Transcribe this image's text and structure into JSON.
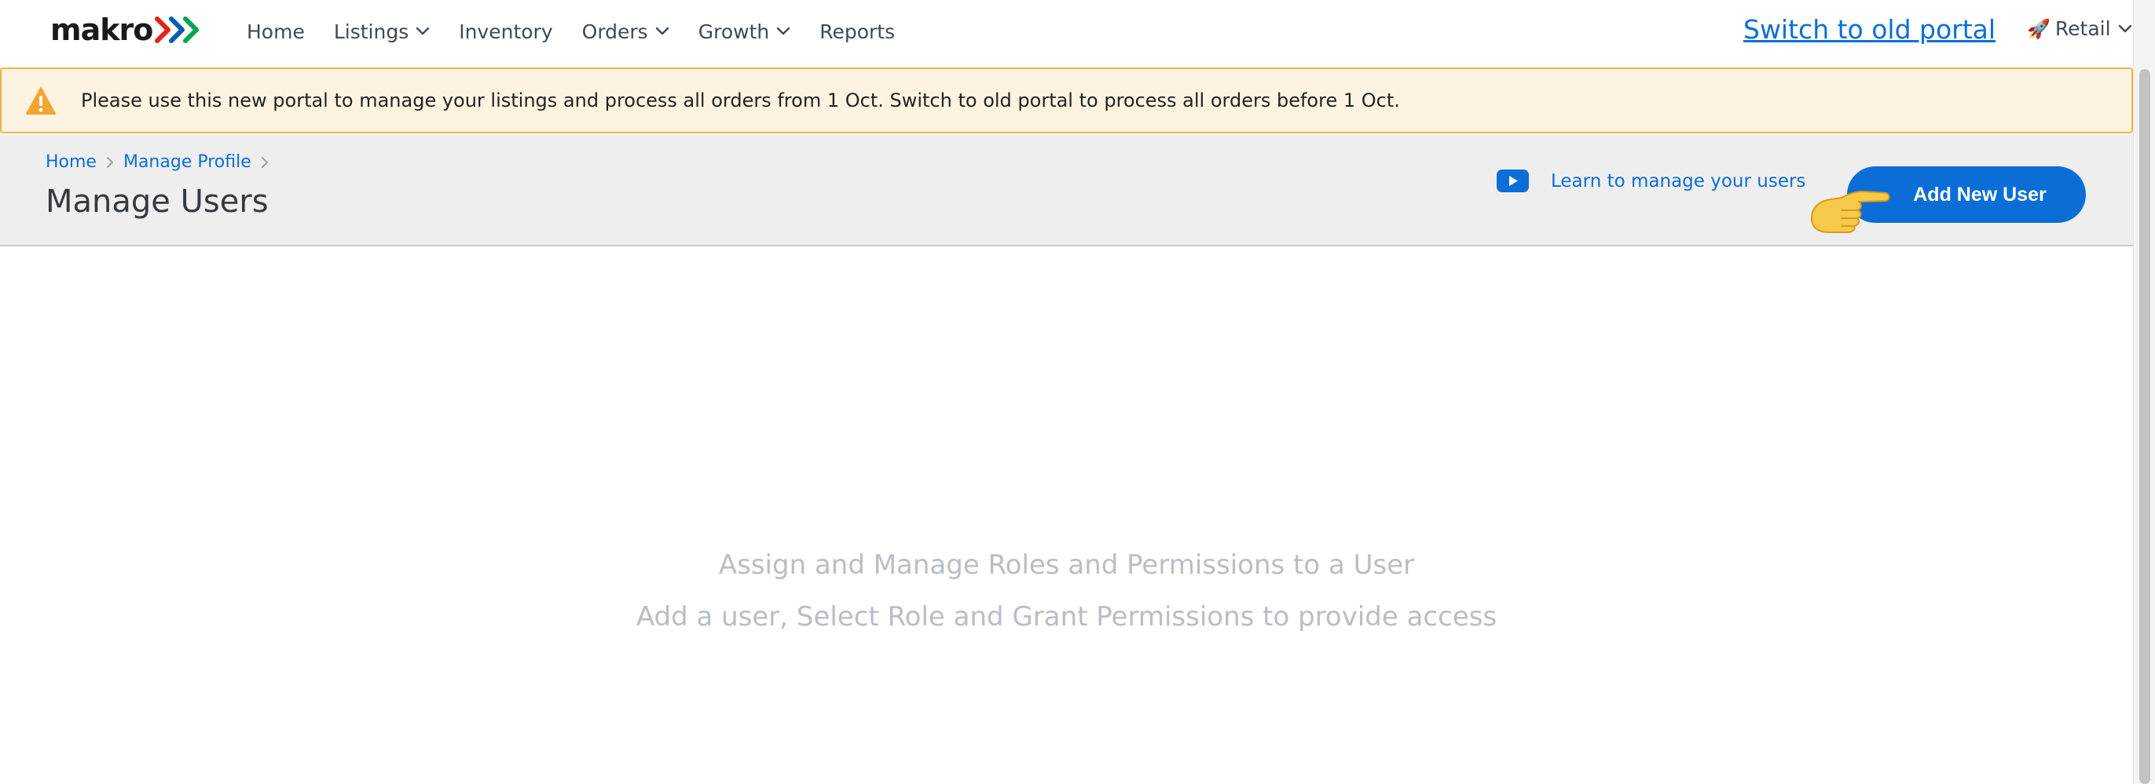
{
  "nav": {
    "logo_text": "makro",
    "logo_colors": [
      "#e2231a",
      "#0060a9",
      "#00a551"
    ],
    "items": [
      {
        "label": "Home",
        "has_dropdown": false
      },
      {
        "label": "Listings",
        "has_dropdown": true
      },
      {
        "label": "Inventory",
        "has_dropdown": false
      },
      {
        "label": "Orders",
        "has_dropdown": true
      },
      {
        "label": "Growth",
        "has_dropdown": true
      },
      {
        "label": "Reports",
        "has_dropdown": false
      }
    ],
    "switch_link": "Switch to old portal",
    "account_icon": "rocket-icon",
    "account_label": "Retail"
  },
  "banner": {
    "icon": "warning-icon",
    "text": "Please use this new portal to manage your listings and process all orders from 1 Oct. Switch to old portal to process all orders before 1 Oct."
  },
  "header": {
    "breadcrumb": [
      "Home",
      "Manage Profile"
    ],
    "title": "Manage Users",
    "learn_icon": "youtube-play-icon",
    "learn_label": "Learn to manage your users",
    "add_button": "Add New User"
  },
  "empty_state": {
    "line1": "Assign and Manage Roles and Permissions to a User",
    "line2": "Add a user, Select Role and Grant Permissions to provide access"
  },
  "colors": {
    "accent": "#0b6ed6",
    "banner_bg": "#fef3e0",
    "banner_border": "#f2b24a",
    "header_bg": "#eeeeee"
  }
}
